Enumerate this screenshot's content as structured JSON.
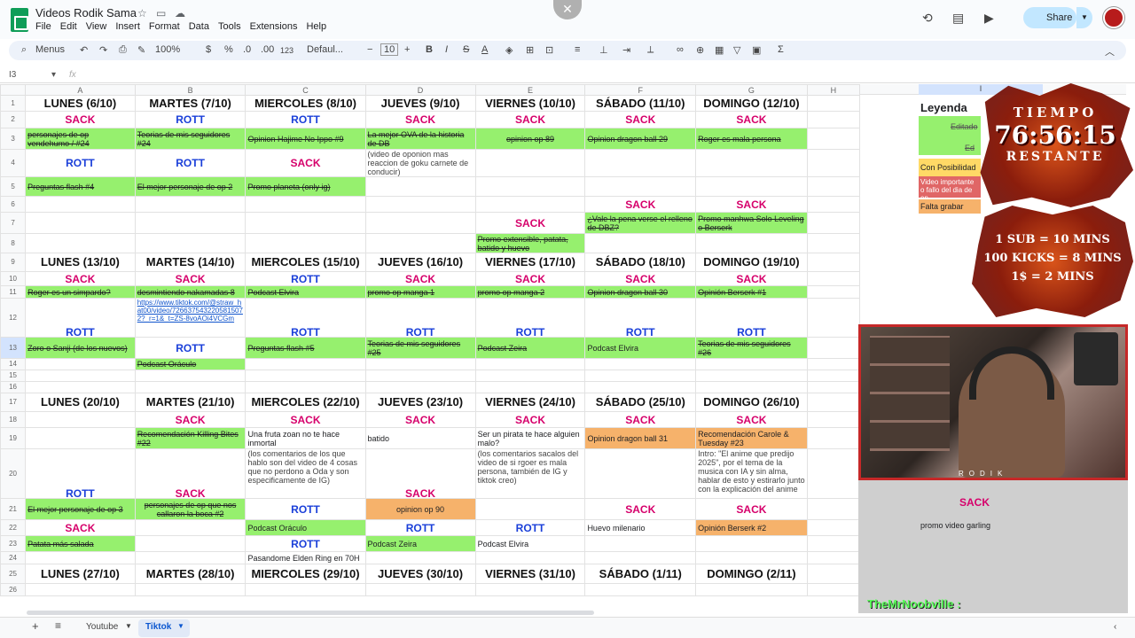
{
  "app": {
    "doc_title": "Videos Rodik Sama",
    "menu": [
      "File",
      "Edit",
      "View",
      "Insert",
      "Format",
      "Data",
      "Tools",
      "Extensions",
      "Help"
    ],
    "share_label": "Share"
  },
  "toolbar": {
    "menus": "Menus",
    "zoom": "100%",
    "currency": "$",
    "percent": "%",
    "dec_less": ".0",
    "dec_more": ".00",
    "num_format": "123",
    "font": "Defaul...",
    "font_size": "10",
    "bold": "B",
    "italic": "I"
  },
  "formula": {
    "cell_ref": "I3",
    "fx": "fx"
  },
  "columns": [
    "A",
    "B",
    "C",
    "D",
    "E",
    "F",
    "G",
    "H",
    "I",
    "J"
  ],
  "grid": {
    "w1": {
      "days": [
        "LUNES (6/10)",
        "MARTES (7/10)",
        "MIERCOLES (8/10)",
        "JUEVES (9/10)",
        "VIERNES (10/10)",
        "SÁBADO (11/10)",
        "DOMINGO (12/10)"
      ],
      "r2": [
        "SACK",
        "ROTT",
        "ROTT",
        "SACK",
        "SACK",
        "SACK",
        "SACK"
      ],
      "r3": [
        "personajes de op vendehumo / #24",
        "Teorias de mis seguidores #24",
        "Opinion Hajime No Ippo #9",
        "La mejor OVA de la historia de DB",
        "opinion op 89",
        "Opinion dragon ball 29",
        "Roger es mala persona"
      ],
      "r3_note": "(video de oponion mas reaccion de goku carnete de conducir)",
      "r4": [
        "ROTT",
        "ROTT",
        "SACK"
      ],
      "r5": [
        "Preguntas flash #4",
        "El mejor personaje de op 2",
        "Promo planeta (only ig)"
      ],
      "r6": [
        "SACK",
        "SACK"
      ],
      "r7": [
        "SACK",
        "¿Vale la pena verse el relleno de DBZ?",
        "Promo manhwa Solo Leveling o Berserk"
      ],
      "r8": "Promo extensible, patata, batido y huevo"
    },
    "w2": {
      "days": [
        "LUNES (13/10)",
        "MARTES (14/10)",
        "MIERCOLES (15/10)",
        "JUEVES (16/10)",
        "VIERNES (17/10)",
        "SÁBADO (18/10)",
        "DOMINGO (19/10)"
      ],
      "r10": [
        "SACK",
        "SACK",
        "ROTT",
        "SACK",
        "SACK",
        "SACK",
        "SACK"
      ],
      "r11": [
        "Roger es un simpardo?",
        "desmintiendo nakamadas 8",
        "Podcast Elvira",
        "promo op manga 1",
        "promo op manga 2",
        "Opinion dragon ball 30",
        "Opinión Berserk #1"
      ],
      "r12_link": "https://www.tiktok.com/@straw_hat00/video/7266375432205815072?_r=1&_t=ZS-8voAOi4VCGm",
      "r12": [
        "ROTT",
        "ROTT",
        "ROTT",
        "ROTT",
        "ROTT",
        "ROTT"
      ],
      "r13": [
        "Zoro o Sanji (de los nuevos)",
        "ROTT",
        "Preguntas flash #5",
        "Teorias de mis seguidores #25",
        "Podcast Zeira",
        "Podcast Elvira",
        "Teorias de mis seguidores #26"
      ],
      "r14": "Podcast Oráculo"
    },
    "w3": {
      "days": [
        "LUNES (20/10)",
        "MARTES (21/10)",
        "MIERCOLES (22/10)",
        "JUEVES (23/10)",
        "VIERNES (24/10)",
        "SÁBADO (25/10)",
        "DOMINGO (26/10)"
      ],
      "r18": [
        "SACK",
        "SACK",
        "SACK",
        "SACK",
        "SACK",
        "SACK"
      ],
      "r19": [
        "Recomendación Killing Bites #22",
        "Una fruta zoan no te hace inmortal",
        "batido",
        "Ser un pirata te hace alguien malo?",
        "Opinion dragon ball 31",
        "Recomendación Carole & Tuesday #23"
      ],
      "r20": [
        "ROTT",
        "SACK",
        "(los comentarios de los que hablo son del video de 4 cosas que no perdono a Oda y son especificamente de IG)",
        "SACK",
        "(los comentarios sacalos del video de si rgoer es mala persona, también de IG y tiktok creo)",
        "Intro: \"El anime que predijo 2025\", por el tema de la musica con IA y sin alma, hablar de esto y estirarlo junto con la explicación del anime"
      ],
      "r21": [
        "El mejor personaje de op 3",
        "personajes de op que nos callaron la boca #2",
        "ROTT",
        "opinion op 90",
        "SACK",
        "SACK"
      ],
      "r22": [
        "SACK",
        "Podcast Oráculo",
        "ROTT",
        "ROTT",
        "Huevo milenario",
        "Opinión Berserk #2"
      ],
      "r23": [
        "Patata más salada",
        "ROTT",
        "Podcast Zeira",
        "Podcast Elvira"
      ],
      "r24": "Pasandome Elden Ring en 70H"
    },
    "w4": {
      "days": [
        "LUNES (27/10)",
        "MARTES (28/10)",
        "MIERCOLES (29/10)",
        "JUEVES (30/10)",
        "VIERNES (31/10)",
        "SÁBADO (1/11)",
        "DOMINGO (2/11)"
      ]
    }
  },
  "legend": {
    "title": "Leyenda",
    "items": [
      "Editado",
      "Ed",
      "Con Posibilidad",
      "Video importante o fallo del dia de en",
      "Falta grabar"
    ]
  },
  "overlay": {
    "timer_top": "TIEMPO",
    "timer_value": "76:56:15",
    "timer_bottom": "RESTANTE",
    "rates": [
      "1 SUB = 10 MINS",
      "100 KICKS = 8 MINS",
      "1$ = 2 MINS"
    ],
    "webcam_label": "RODIK",
    "right_sack": "SACK",
    "right_note": "promo video garling",
    "chat_user": "TheMrNoobville :"
  },
  "sheets": [
    "Youtube",
    "Tiktok"
  ],
  "colors": {
    "sack": "#d6006b",
    "rott": "#1a3fd9",
    "green": "#96f06e",
    "orange": "#f6b26b"
  }
}
